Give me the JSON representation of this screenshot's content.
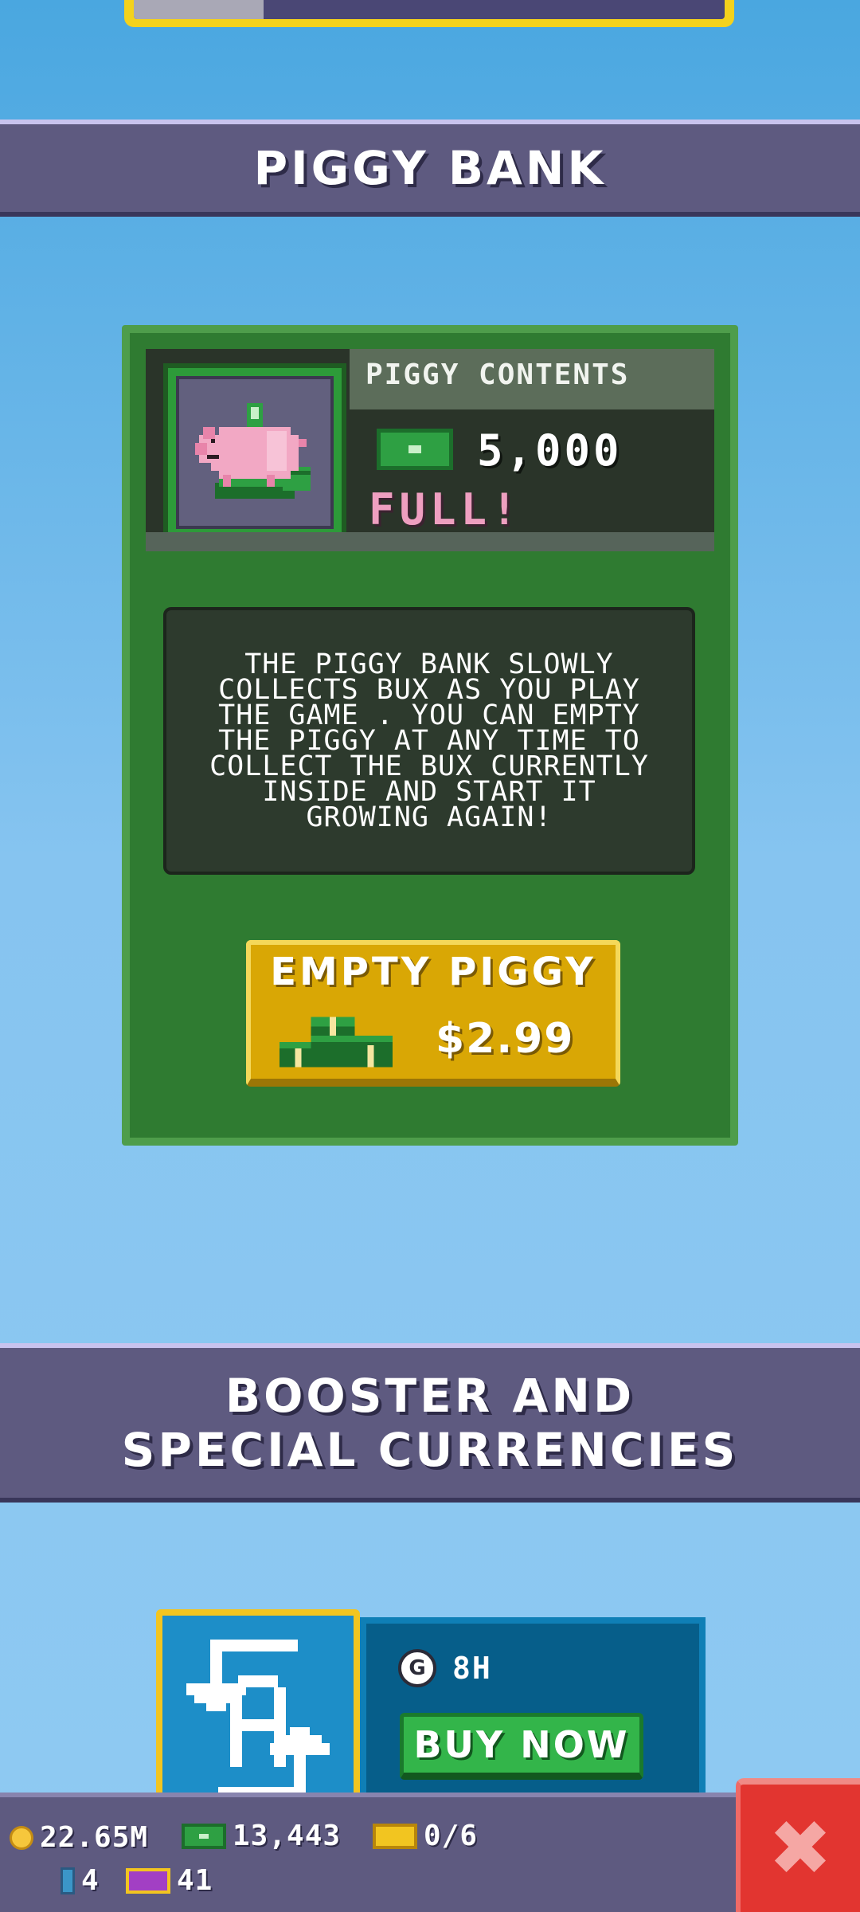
{
  "top_progress": {
    "fill_fraction": 0.22
  },
  "piggy_section": {
    "title": "PIGGY BANK",
    "contents_label": "PIGGY CONTENTS",
    "amount": "5,000",
    "status": "FULL!",
    "description": "The piggy bank slowly collects bux as you play the game . You can empty the piggy at any time to collect the bux currently inside and start it growing again!",
    "button_label": "EMPTY PIGGY",
    "button_price": "$2.99"
  },
  "booster_section": {
    "title": "BOOSTER AND SPECIAL CURRENCIES",
    "timer": "8H",
    "timer_icon_letter": "G",
    "buy_label": "BUY NOW",
    "booster_icon_letter": "A"
  },
  "resources": {
    "coins": "22.65M",
    "bux": "13,443",
    "tickets": "0/6",
    "gems": "4",
    "special_tickets": "41"
  },
  "colors": {
    "header_bg": "#5e5a80",
    "card_green": "#2f7b31",
    "button_gold": "#d9a705",
    "close_red": "#e23530",
    "status_pink": "#ee9fc0"
  }
}
